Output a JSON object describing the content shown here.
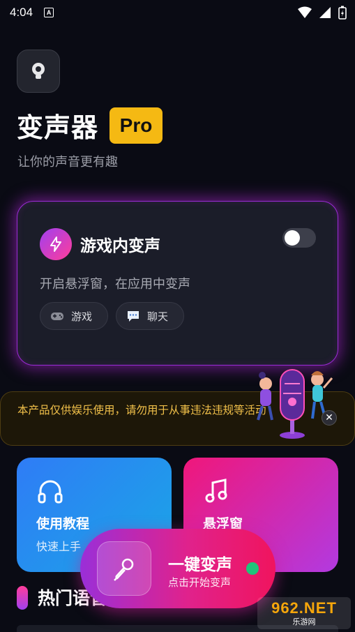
{
  "status_bar": {
    "time": "4:04",
    "notification_icon": "A"
  },
  "header": {
    "logo_icon": "skull-mic-icon",
    "title": "变声器",
    "badge": "Pro",
    "subtitle": "让你的声音更有趣"
  },
  "game_card": {
    "icon": "bolt-icon",
    "title": "游戏内变声",
    "description": "开启悬浮窗，在应用中变声",
    "toggle_on": false,
    "chips": [
      {
        "icon": "gamepad-icon",
        "label": "游戏"
      },
      {
        "icon": "chat-bubble-icon",
        "label": "聊天"
      }
    ],
    "glow_color": "#b428dc"
  },
  "notice": {
    "text": "本产品仅供娱乐使用，请勿用于从事违法违规等活动",
    "close_label": "✕",
    "text_color": "#f2c14a"
  },
  "features": [
    {
      "icon": "headphones-icon",
      "title": "使用教程",
      "subtitle": "快速上手"
    },
    {
      "icon": "music-note-icon",
      "title": "悬浮窗",
      "subtitle": ""
    }
  ],
  "section": {
    "title": "热门语音"
  },
  "main_button": {
    "icon": "microphone-icon",
    "title": "一键变声",
    "subtitle": "点击开始变声",
    "status_color": "#20c37a"
  },
  "watermark": {
    "main": "962.NET",
    "sub": "乐游网"
  }
}
